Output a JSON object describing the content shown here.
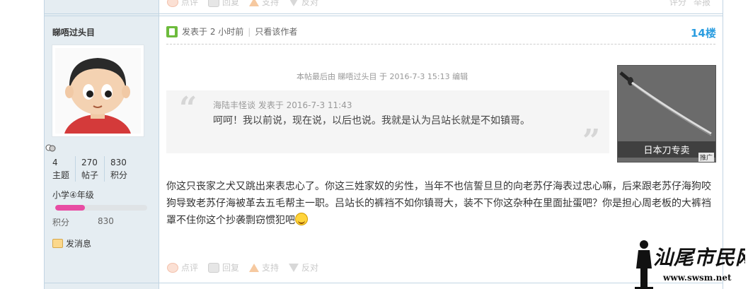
{
  "prev_actions": {
    "comment": "点评",
    "reply": "回复",
    "support": "支持",
    "oppose": "反对",
    "rate": "评分",
    "report": "举报"
  },
  "author": {
    "name": "睇唔过头目",
    "stats": [
      {
        "value": "4",
        "label": "主题"
      },
      {
        "value": "270",
        "label": "帖子"
      },
      {
        "value": "830",
        "label": "积分"
      }
    ],
    "grade": "小学④年级",
    "level_progress": 0.32,
    "score_label": "积分",
    "score_value": "830",
    "pm_label": "发消息"
  },
  "post": {
    "posted_at": "发表于 2 小时前",
    "only_author": "只看该作者",
    "floor": "14楼",
    "edit_note": "本帖最后由 睇唔过头目 于 2016-7-3 15:13 编辑",
    "quote_meta": "海陆丰怪谈 发表于 2016-7-3 11:43",
    "quote_text": "呵呵！我以前说，现在说，以后也说。我就是认为吕站长就是不如镇哥。",
    "message": "你这只丧家之犬又跳出来表忠心了。你这三姓家奴的劣性，当年不也信誓旦旦的向老苏仔海表过忠心嘛，后来跟老苏仔海狗咬狗导致老苏仔海被革去五毛帮主一职。吕站长的裤裆不如你镇哥大，装不下你这杂种在里面扯蛋吧？你是担心周老板的大裤裆罩不住你这个抄袭剽窃惯犯吧"
  },
  "ad": {
    "label": "日本刀专卖",
    "tag": "推广"
  },
  "actions": {
    "comment": "点评",
    "reply": "回复",
    "support": "支持",
    "oppose": "反对"
  },
  "watermark": {
    "text": "汕尾市民网",
    "url": "www.swsm.net"
  }
}
